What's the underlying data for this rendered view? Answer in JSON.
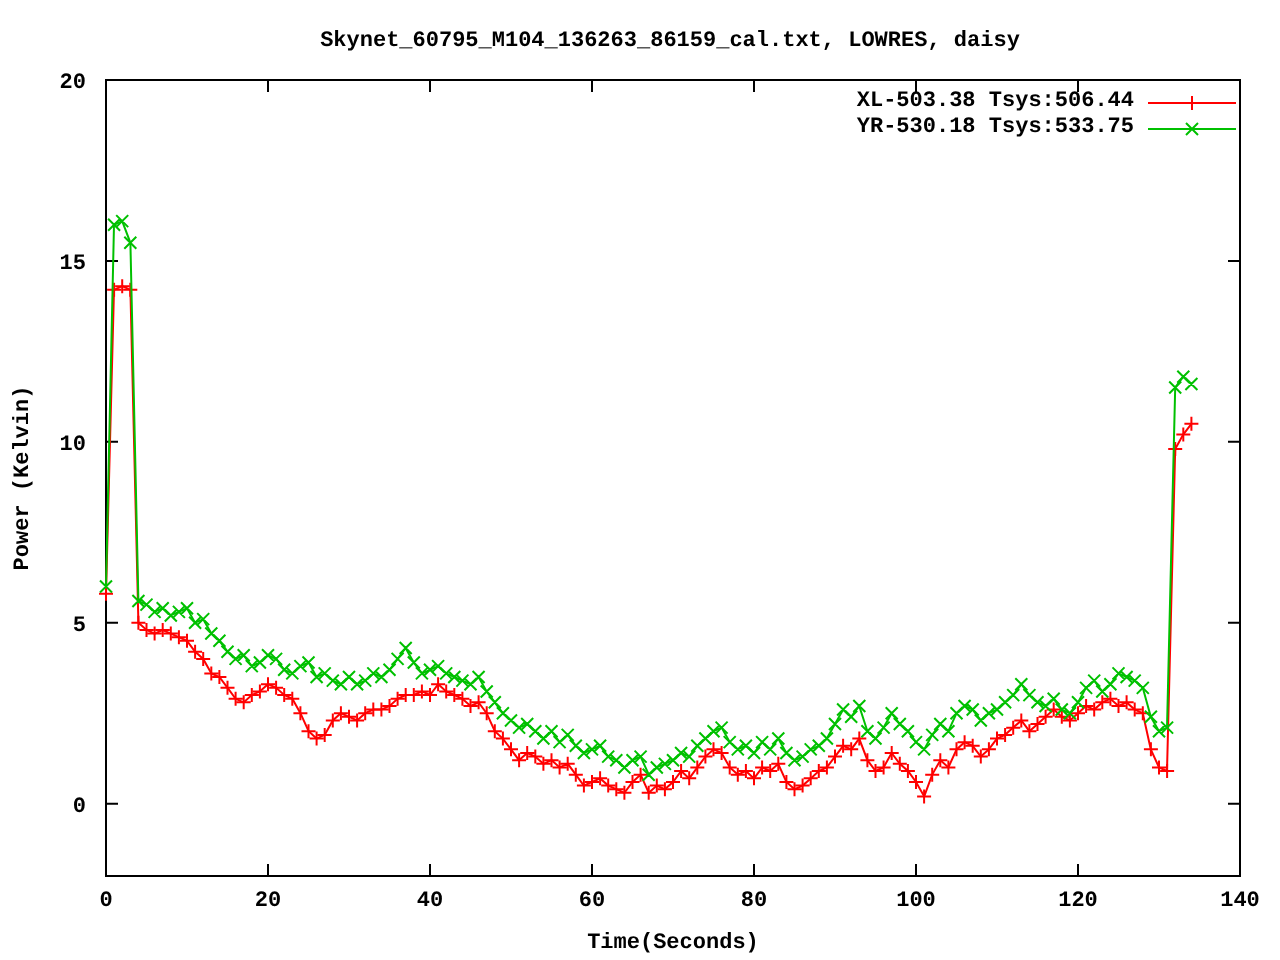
{
  "chart_data": {
    "type": "line",
    "title": "Skynet_60795_M104_136263_86159_cal.txt, LOWRES, daisy",
    "xlabel": "Time(Seconds)",
    "ylabel": "Power (Kelvin)",
    "xlim": [
      0,
      140
    ],
    "ylim": [
      -2,
      20
    ],
    "xticks": [
      0,
      20,
      40,
      60,
      80,
      100,
      120,
      140
    ],
    "yticks": [
      0,
      5,
      10,
      15,
      20
    ],
    "legend": true,
    "x": [
      0,
      1,
      2,
      3,
      4,
      5,
      6,
      7,
      8,
      9,
      10,
      11,
      12,
      13,
      14,
      15,
      16,
      17,
      18,
      19,
      20,
      21,
      22,
      23,
      24,
      25,
      26,
      27,
      28,
      29,
      30,
      31,
      32,
      33,
      34,
      35,
      36,
      37,
      38,
      39,
      40,
      41,
      42,
      43,
      44,
      45,
      46,
      47,
      48,
      49,
      50,
      51,
      52,
      53,
      54,
      55,
      56,
      57,
      58,
      59,
      60,
      61,
      62,
      63,
      64,
      65,
      66,
      67,
      68,
      69,
      70,
      71,
      72,
      73,
      74,
      75,
      76,
      77,
      78,
      79,
      80,
      81,
      82,
      83,
      84,
      85,
      86,
      87,
      88,
      89,
      90,
      91,
      92,
      93,
      94,
      95,
      96,
      97,
      98,
      99,
      100,
      101,
      102,
      103,
      104,
      105,
      106,
      107,
      108,
      109,
      110,
      111,
      112,
      113,
      114,
      115,
      116,
      117,
      118,
      119,
      120,
      121,
      122,
      123,
      124,
      125,
      126,
      127,
      128,
      129,
      130,
      131,
      132,
      133,
      134
    ],
    "series": [
      {
        "name": "XL-503.38 Tsys:506.44",
        "color": "#ff0000",
        "marker": "plus",
        "values": [
          5.8,
          14.2,
          14.3,
          14.2,
          5.0,
          4.8,
          4.7,
          4.8,
          4.7,
          4.6,
          4.5,
          4.2,
          4.0,
          3.6,
          3.5,
          3.2,
          2.9,
          2.8,
          3.0,
          3.1,
          3.3,
          3.2,
          3.0,
          2.9,
          2.5,
          2.0,
          1.8,
          1.9,
          2.3,
          2.5,
          2.4,
          2.3,
          2.5,
          2.6,
          2.6,
          2.7,
          2.9,
          3.0,
          3.0,
          3.1,
          3.0,
          3.3,
          3.1,
          3.0,
          2.9,
          2.7,
          2.8,
          2.5,
          2.0,
          1.8,
          1.5,
          1.2,
          1.4,
          1.3,
          1.1,
          1.2,
          1.0,
          1.1,
          0.8,
          0.5,
          0.6,
          0.7,
          0.5,
          0.4,
          0.3,
          0.6,
          0.8,
          0.3,
          0.5,
          0.4,
          0.6,
          0.9,
          0.7,
          1.0,
          1.3,
          1.5,
          1.4,
          1.0,
          0.8,
          0.9,
          0.7,
          1.0,
          0.9,
          1.1,
          0.6,
          0.4,
          0.5,
          0.7,
          0.9,
          1.0,
          1.3,
          1.6,
          1.5,
          1.8,
          1.2,
          0.9,
          1.0,
          1.4,
          1.1,
          0.9,
          0.6,
          0.2,
          0.8,
          1.2,
          1.0,
          1.5,
          1.7,
          1.6,
          1.3,
          1.5,
          1.8,
          1.9,
          2.1,
          2.3,
          2.0,
          2.2,
          2.4,
          2.6,
          2.4,
          2.3,
          2.5,
          2.7,
          2.6,
          2.8,
          2.9,
          2.7,
          2.8,
          2.6,
          2.5,
          1.5,
          1.0,
          0.9,
          9.8,
          10.2,
          10.5
        ]
      },
      {
        "name": "YR-530.18 Tsys:533.75",
        "color": "#00c000",
        "marker": "cross",
        "values": [
          6.0,
          16.0,
          16.1,
          15.5,
          5.6,
          5.5,
          5.3,
          5.4,
          5.2,
          5.3,
          5.4,
          5.0,
          5.1,
          4.7,
          4.5,
          4.2,
          4.0,
          4.1,
          3.8,
          3.9,
          4.1,
          4.0,
          3.7,
          3.6,
          3.8,
          3.9,
          3.5,
          3.6,
          3.4,
          3.3,
          3.5,
          3.3,
          3.4,
          3.6,
          3.5,
          3.7,
          4.0,
          4.3,
          3.9,
          3.6,
          3.7,
          3.8,
          3.6,
          3.5,
          3.4,
          3.3,
          3.5,
          3.1,
          2.8,
          2.5,
          2.3,
          2.1,
          2.2,
          2.0,
          1.8,
          2.0,
          1.7,
          1.9,
          1.6,
          1.4,
          1.5,
          1.6,
          1.3,
          1.2,
          1.0,
          1.2,
          1.3,
          0.8,
          1.0,
          1.1,
          1.2,
          1.4,
          1.3,
          1.6,
          1.8,
          2.0,
          2.1,
          1.7,
          1.5,
          1.6,
          1.4,
          1.7,
          1.5,
          1.8,
          1.4,
          1.2,
          1.3,
          1.5,
          1.6,
          1.8,
          2.2,
          2.6,
          2.4,
          2.7,
          2.0,
          1.8,
          2.1,
          2.5,
          2.2,
          2.0,
          1.7,
          1.5,
          1.9,
          2.2,
          2.0,
          2.5,
          2.7,
          2.6,
          2.3,
          2.5,
          2.6,
          2.8,
          3.0,
          3.3,
          3.0,
          2.8,
          2.7,
          2.9,
          2.6,
          2.5,
          2.8,
          3.2,
          3.4,
          3.1,
          3.3,
          3.6,
          3.5,
          3.4,
          3.2,
          2.4,
          2.0,
          2.1,
          11.5,
          11.8,
          11.6
        ]
      }
    ]
  }
}
